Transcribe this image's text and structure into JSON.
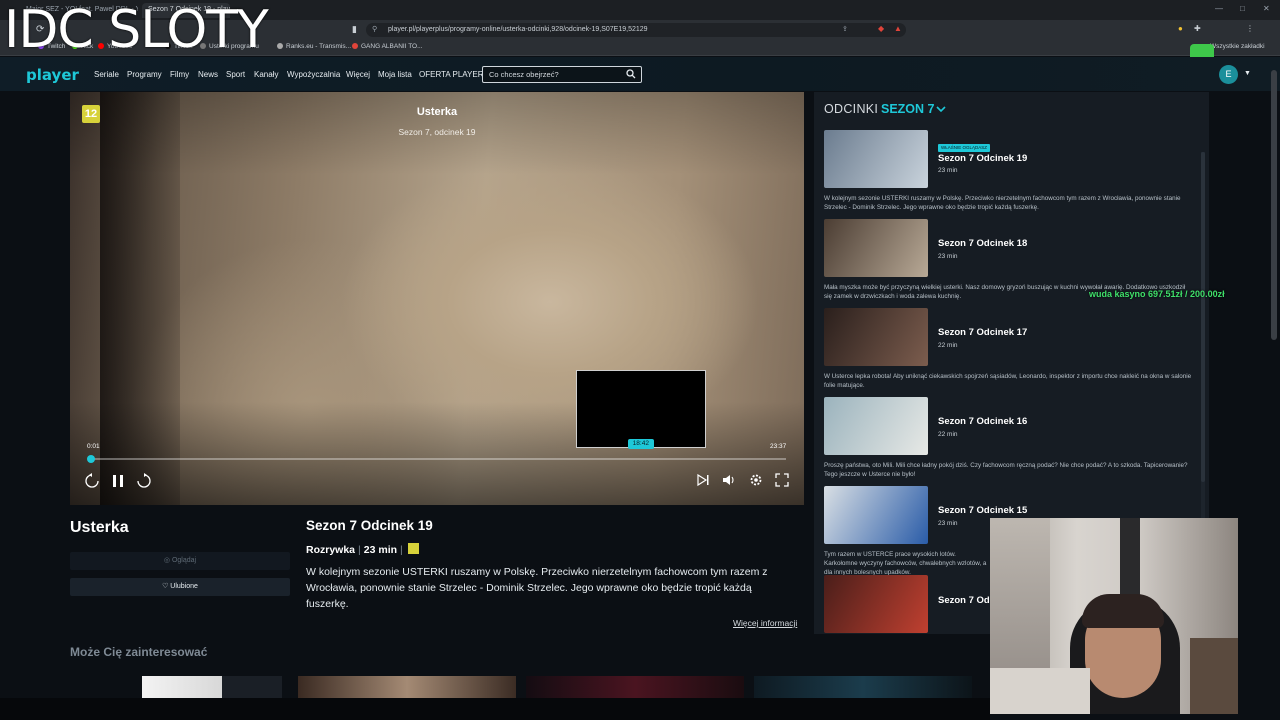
{
  "overlay": {
    "title": "IDC SLOTY"
  },
  "browser": {
    "tabs": [
      "Major SEZ - YOI feat. Pawel DDL - Yo",
      "Sezon 7 Odcinek 19 - player"
    ],
    "url": "player.pl/playerplus/programy-online/usterka-odcinki,928/odcinek-19,S07E19,52129",
    "bookmarks": [
      "Twitch",
      "Kick",
      "YouTube",
      "TikTok",
      "Usterki programu",
      "Ranks.eu - Transmis...",
      "GANG ALBANII TO..."
    ],
    "all_bookmarks": "Wszystkie zakładki"
  },
  "site": {
    "logo": "player",
    "nav": [
      "Seriale",
      "Programy",
      "Filmy",
      "News",
      "Sport",
      "Kanały",
      "Wypożyczalnia",
      "Więcej",
      "Moja lista",
      "OFERTA PLAYER"
    ],
    "search_placeholder": "Co chcesz obejrzeć?",
    "avatar_initial": "E"
  },
  "player": {
    "age_rating": "12",
    "title": "Usterka",
    "subtitle": "Sezon 7, odcinek 19",
    "time_current": "0:01",
    "time_total": "23:37",
    "preview_time": "18:42",
    "progress": 0.002,
    "preview_position": 0.792
  },
  "details": {
    "show_title": "Usterka",
    "watched_label": "Oglądaj",
    "favorite_label": "Ulubione",
    "episode_title": "Sezon 7 Odcinek 19",
    "genre": "Rozrywka",
    "duration": "23 min",
    "description": "W kolejnym sezonie USTERKI ruszamy w Polskę. Przeciwko nierzetelnym fachowcom tym razem z Wrocławia, ponownie stanie Strzelec - Dominik Strzelec. Jego wprawne oko będzie tropić każdą fuszerkę.",
    "more_info": "Więcej informacji"
  },
  "related": {
    "title": "Może Cię zainteresować"
  },
  "episodes_panel": {
    "label": "ODCINKI",
    "season": "SEZON 7",
    "new_badge": "WŁAŚNIE OGLĄDASZ",
    "items": [
      {
        "name": "Sezon 7 Odcinek 19",
        "duration": "23 min",
        "text": "W kolejnym sezonie USTERKI ruszamy w Polskę. Przeciwko nierzetelnym fachowcom tym razem z Wrocławia, ponownie stanie Strzelec - Dominik Strzelec. Jego wprawne oko będzie tropić każdą fuszerkę.",
        "thumb_colors": [
          "#6b7c8f",
          "#c9d3dc"
        ]
      },
      {
        "name": "Sezon 7 Odcinek 18",
        "duration": "23 min",
        "text": "Mała myszka może być przyczyną wielkiej usterki. Nasz domowy gryzoń buszując w kuchni wywołał awarię. Dodatkowo uszkodził się zamek w drzwiczkach i woda zalewa kuchnię.",
        "thumb_colors": [
          "#4b3d33",
          "#b8a996"
        ]
      },
      {
        "name": "Sezon 7 Odcinek 17",
        "duration": "22 min",
        "text": "W Usterce lepka robota! Aby uniknąć ciekawskich spojrzeń sąsiadów, Leonardo, inspektor z importu chce nakleić na okna w salonie folie matujące.",
        "thumb_colors": [
          "#2a1f1c",
          "#7c5d4e"
        ]
      },
      {
        "name": "Sezon 7 Odcinek 16",
        "duration": "22 min",
        "text": "Proszę państwa, oto Mili. Mili chce ładny pokój dziś. Czy fachowcom ręczną podać? Nie chce podać? A to szkoda. Tapicerowanie? Tego jeszcze w Usterce nie było!",
        "thumb_colors": [
          "#9bb3bd",
          "#e7e9e6"
        ]
      },
      {
        "name": "Sezon 7 Odcinek 15",
        "duration": "23 min",
        "text": "Tym razem w USTERCE prace wysokich lotów. Karkołomne wyczyny fachowców, chwalebnych wzlotów, a dla innych bolesnych upadków.",
        "thumb_colors": [
          "#d9dfe4",
          "#2a5ca8"
        ]
      },
      {
        "name": "Sezon 7 Odcinek 14",
        "duration": "",
        "text": "",
        "thumb_colors": [
          "#4a1e1a",
          "#c04030"
        ]
      }
    ]
  },
  "webcam_overlay": "wuda kasyno 697.51zł / 200.00zł",
  "colors": {
    "accent": "#1ec8d8",
    "age_badge": "#d7d23a"
  }
}
